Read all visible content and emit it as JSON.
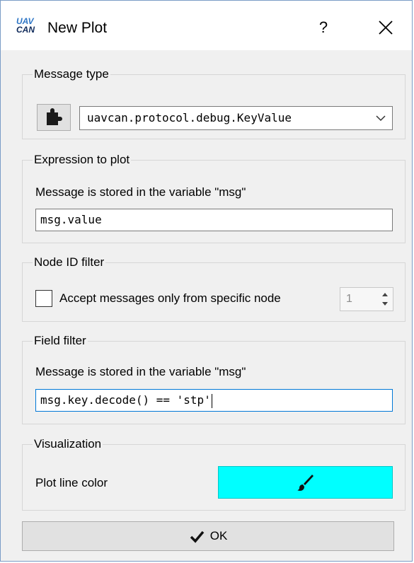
{
  "window": {
    "logo_line1": "UAV",
    "logo_line2": "CAN",
    "title": "New Plot",
    "help_label": "?"
  },
  "message_type": {
    "group_title": "Message type",
    "selected": "uavcan.protocol.debug.KeyValue",
    "picker_icon": "puzzle-piece-icon"
  },
  "expression": {
    "group_title": "Expression to plot",
    "hint": "Message is stored in the variable \"msg\"",
    "value": "msg.value"
  },
  "node_filter": {
    "group_title": "Node ID filter",
    "checkbox_label": "Accept messages only from specific node",
    "checked": false,
    "node_id": "1"
  },
  "field_filter": {
    "group_title": "Field filter",
    "hint": "Message is stored in the variable \"msg\"",
    "value": "msg.key.decode() == 'stp'"
  },
  "visualization": {
    "group_title": "Visualization",
    "color_label": "Plot line color",
    "color": "#00ffff",
    "color_icon": "paintbrush-icon"
  },
  "actions": {
    "ok_label": "OK"
  }
}
